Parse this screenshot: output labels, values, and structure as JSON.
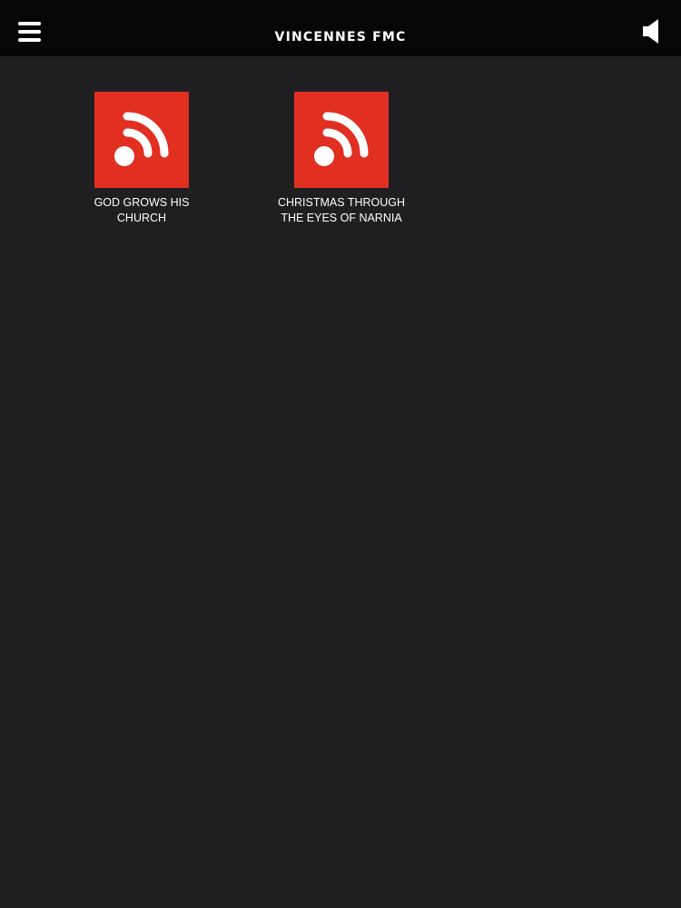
{
  "header": {
    "title": "VINCENNES FMC",
    "menu_icon": "hamburger-menu-icon",
    "volume_icon": "volume-speaker-icon",
    "background_color": "#060606"
  },
  "content": {
    "background_color": "#1f1e20",
    "tiles": [
      {
        "label": "GOD GROWS HIS CHURCH",
        "icon": "rss-feed-icon",
        "icon_color": "#e12f22"
      },
      {
        "label": "CHRISTMAS THROUGH THE EYES OF NARNIA",
        "icon": "rss-feed-icon",
        "icon_color": "#e12f22"
      }
    ]
  }
}
